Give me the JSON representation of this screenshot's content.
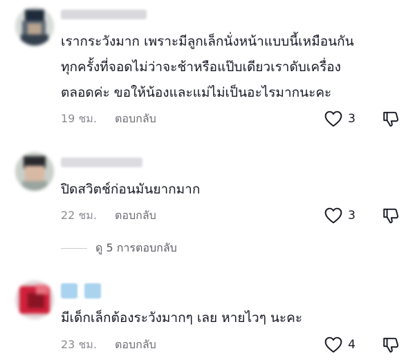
{
  "comments": [
    {
      "text": "เรากระวังมาก เพราะมีลูกเล็กนั่งหน้าแบบนี้เหมือนกัน\nทุกครั้งที่จอดไม่ว่าจะช้าหรือแป๊บเดียวเราดับเครื่อง\nตลอดค่ะ ขอให้น้องและแม่ไม่เป็นอะไรมากนะคะ",
      "time": "19 ชม.",
      "reply_label": "ตอบกลับ",
      "likes": "3"
    },
    {
      "text": "ปิดสวิตช์ก่อนมันยากมาก",
      "time": "22 ชม.",
      "reply_label": "ตอบกลับ",
      "likes": "3"
    },
    {
      "text": "มีเด็กเล็กต้องระวังมากๆ เลย หายไวๆ นะคะ",
      "time": "23 ชม.",
      "reply_label": "ตอบกลับ",
      "likes": "4"
    }
  ],
  "view_replies_label": "ดู 5 การตอบกลับ",
  "colors": {
    "text": "#161823",
    "muted": "#8a8b91",
    "icon": "#161823",
    "username_blur": "#d4d4d8",
    "user_icon": "#a9d3ee"
  }
}
